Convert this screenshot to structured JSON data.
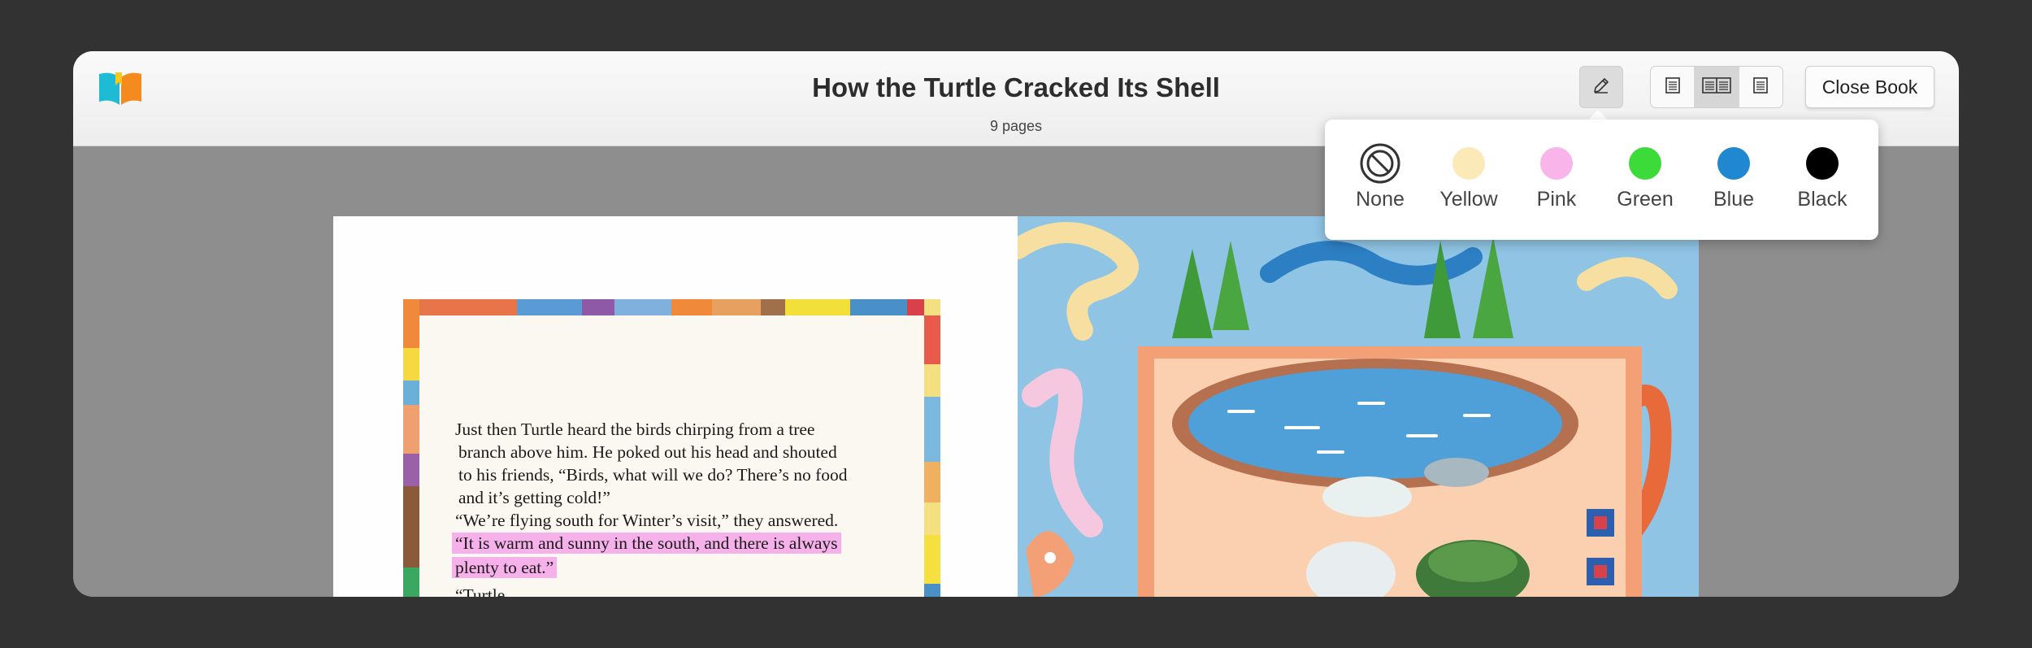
{
  "header": {
    "title": "How the Turtle Cracked Its Shell",
    "page_count": "9 pages",
    "close_label": "Close Book"
  },
  "icons": {
    "logo": "open-book-logo",
    "highlighter": "pencil-icon",
    "views": [
      "single-page-icon",
      "two-page-icon",
      "single-page-icon"
    ]
  },
  "view_mode_selected": "two-page",
  "highlight_colors": [
    {
      "label": "None",
      "color": "#ffffff",
      "icon": "no-highlight-icon"
    },
    {
      "label": "Yellow",
      "color": "#fbe9b7"
    },
    {
      "label": "Pink",
      "color": "#f9b4ea"
    },
    {
      "label": "Green",
      "color": "#3ddb3a"
    },
    {
      "label": "Blue",
      "color": "#1f88d0"
    },
    {
      "label": "Black",
      "color": "#000000"
    }
  ],
  "story": {
    "paragraph1": [
      "Just then Turtle heard the birds chirping from a tree",
      "branch above him. He poked out his head and shouted",
      "to his friends, “Birds, what will we do? There’s no food",
      "and it’s getting cold!”"
    ],
    "paragraph2_line1": "“We’re flying south for Winter’s visit,” they answered.",
    "highlighted": [
      "“It is warm and sunny in the south, and there is always",
      "plenty to eat.”"
    ],
    "highlight_color": "#f6b0ea",
    "next_fragment": "“Turtle"
  },
  "colors": {
    "background": "#323232",
    "reader_area": "#8e8e8e",
    "header_bg": "#f5f5f5"
  }
}
